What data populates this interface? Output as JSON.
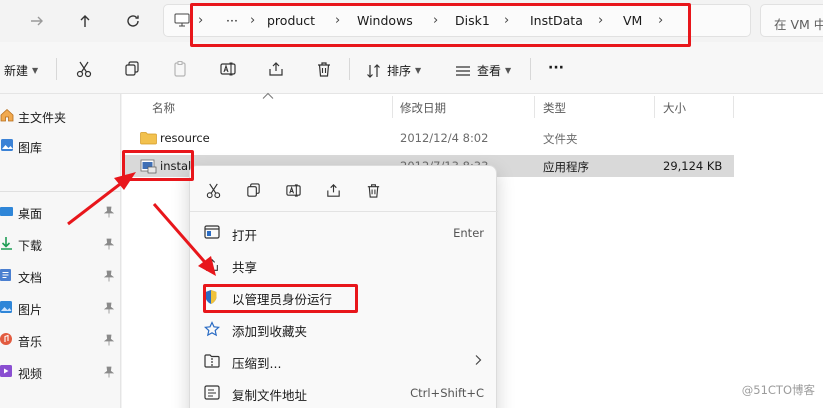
{
  "address": {
    "ellipsis": "···",
    "crumbs": [
      "product",
      "Windows",
      "Disk1",
      "InstData",
      "VM"
    ],
    "search_placeholder": "在 VM 中"
  },
  "toolbar": {
    "new_label": "新建",
    "sort_label": "排序",
    "view_label": "查看",
    "more_label": "···"
  },
  "sidebar": {
    "items": [
      {
        "label": "主文件夹",
        "icon": "home-icon"
      },
      {
        "label": "图库",
        "icon": "gallery-icon"
      },
      {
        "label": "桌面",
        "icon": "desktop-icon"
      },
      {
        "label": "下载",
        "icon": "download-icon"
      },
      {
        "label": "文档",
        "icon": "documents-icon"
      },
      {
        "label": "图片",
        "icon": "pictures-icon"
      },
      {
        "label": "音乐",
        "icon": "music-icon"
      },
      {
        "label": "视频",
        "icon": "videos-icon"
      }
    ]
  },
  "columns": {
    "name": "名称",
    "modified": "修改日期",
    "type": "类型",
    "size": "大小"
  },
  "files": [
    {
      "name": "resource",
      "modified": "2012/12/4 8:02",
      "type": "文件夹",
      "size": ""
    },
    {
      "name": "install",
      "modified": "2012/7/13 8:33",
      "type": "应用程序",
      "size": "29,124 KB"
    }
  ],
  "context_menu": {
    "items": [
      {
        "label": "打开",
        "shortcut": "Enter"
      },
      {
        "label": "共享",
        "shortcut": ""
      },
      {
        "label": "以管理员身份运行",
        "shortcut": ""
      },
      {
        "label": "添加到收藏夹",
        "shortcut": ""
      },
      {
        "label": "压缩到...",
        "shortcut": ""
      },
      {
        "label": "复制文件地址",
        "shortcut": "Ctrl+Shift+C"
      }
    ]
  },
  "watermark": "@51CTO博客",
  "colors": {
    "annotation_red": "#e8161b",
    "folder_yellow": "#f2c14e",
    "accent_blue": "#2b6cc4",
    "selected_row": "#d9d9d9"
  }
}
